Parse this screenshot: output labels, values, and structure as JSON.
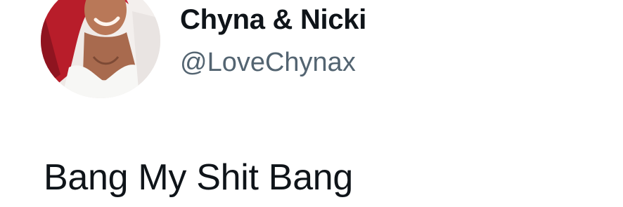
{
  "tweet": {
    "author": {
      "display_name": "Chyna & Nicki",
      "handle": "@LoveChynax",
      "avatar_icon": "profile-photo"
    },
    "text": "Bang My Shit Bang"
  },
  "colors": {
    "text_primary": "#0f1419",
    "text_secondary": "#536471",
    "background": "#ffffff"
  }
}
